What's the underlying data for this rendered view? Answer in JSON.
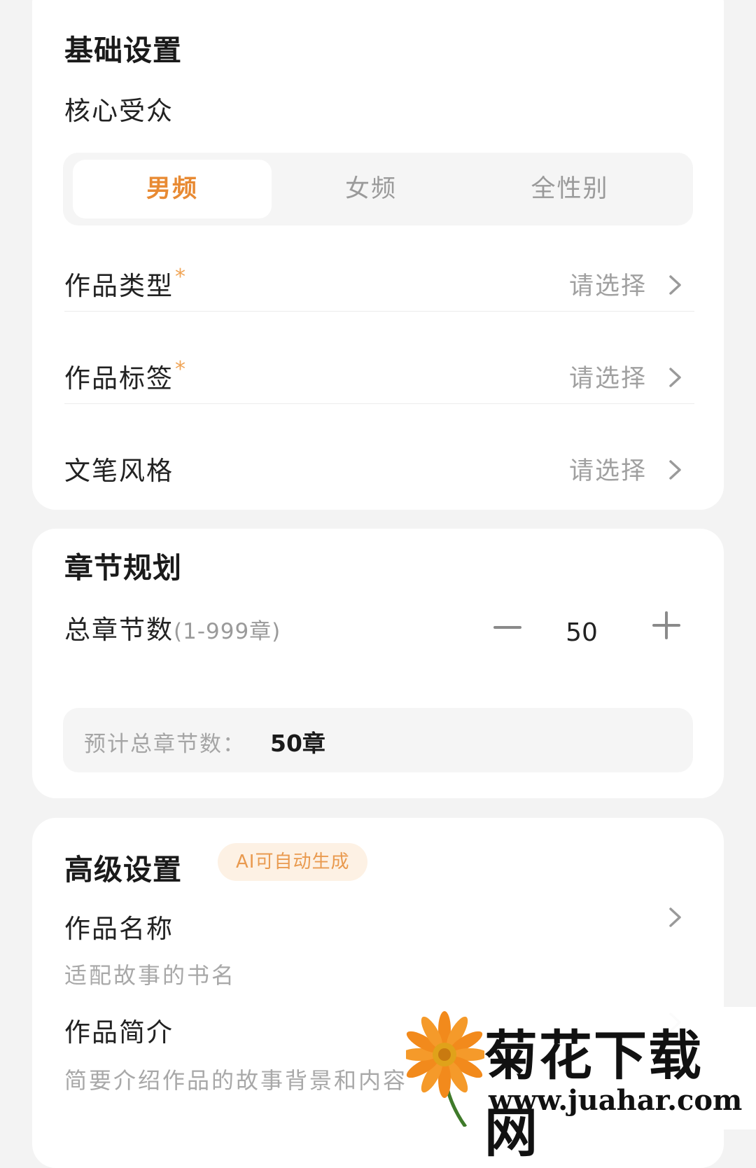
{
  "basic": {
    "title": "基础设置",
    "audience_label": "核心受众",
    "audience_options": [
      "男频",
      "女频",
      "全性别"
    ],
    "selected_audience": "男频",
    "rows": [
      {
        "label": "作品类型",
        "required": "*",
        "value": "请选择"
      },
      {
        "label": "作品标签",
        "required": "*",
        "value": "请选择"
      },
      {
        "label": "文笔风格",
        "value": "请选择"
      }
    ]
  },
  "chapters": {
    "title": "章节规划",
    "total_label": "总章节数",
    "range": "(1-999章)",
    "count": "50",
    "estimate_label": "预计总章节数：",
    "estimate_value": "50章"
  },
  "advanced": {
    "title": "高级设置",
    "badge": "AI可自动生成",
    "items": [
      {
        "label": "作品名称",
        "hint": "适配故事的书名"
      },
      {
        "label": "作品简介",
        "hint": "简要介绍作品的故事背景和内容"
      }
    ]
  },
  "watermark": {
    "title": "菊花下载网",
    "url": "www.juahar.com"
  },
  "colors": {
    "accent": "#e88a33",
    "badge_bg": "#fdf1e4",
    "page_bg": "#f3f3f3"
  }
}
